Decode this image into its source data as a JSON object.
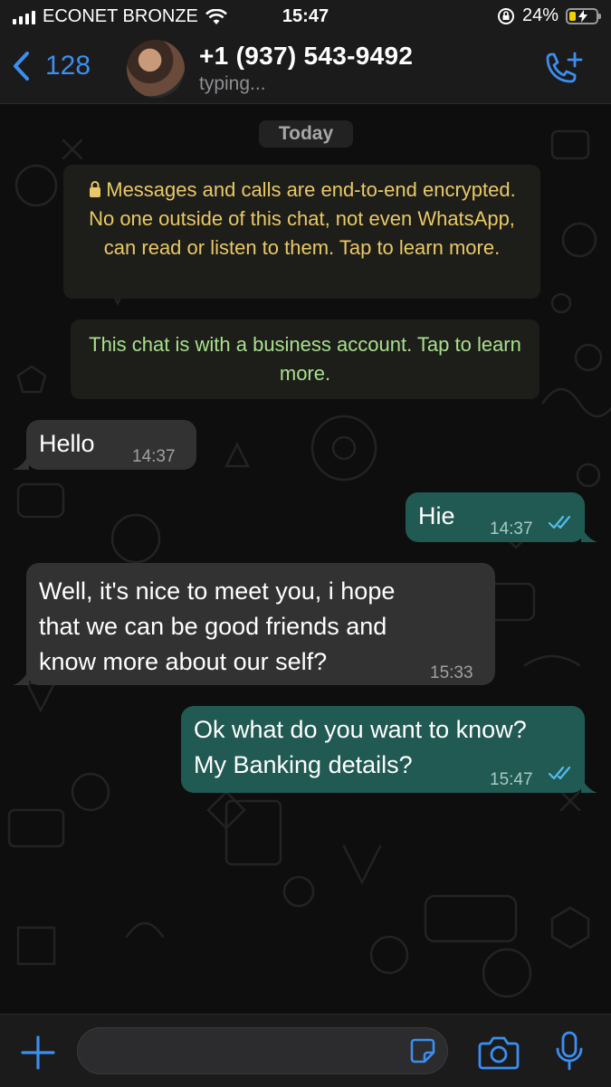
{
  "status_bar": {
    "carrier": "ECONET BRONZE",
    "time": "15:47",
    "battery": "24%",
    "battery_level": 0.24
  },
  "header": {
    "back_count": "128",
    "contact_name": "+1 (937) 543-9492",
    "contact_status": "typing...",
    "icons": [
      "chevron-left-icon",
      "avatar",
      "add-call-icon"
    ]
  },
  "chat": {
    "day_label": "Today",
    "encryption_notice": "Messages and calls are end-to-end encrypted. No one outside of this chat, not even WhatsApp, can read or listen to them. Tap to learn more.",
    "business_notice": "This chat is with a business account. Tap to learn more.",
    "messages": [
      {
        "direction": "incoming",
        "lines": [
          "Hello"
        ],
        "time": "14:37"
      },
      {
        "direction": "outgoing",
        "lines": [
          "Hie"
        ],
        "time": "14:37",
        "read": true
      },
      {
        "direction": "incoming",
        "lines": [
          "Well, it's nice to meet you, i hope",
          "that we can be good friends and",
          "know more about our self?"
        ],
        "time": "15:33"
      },
      {
        "direction": "outgoing",
        "lines": [
          "Ok what do you want to know?",
          "My Banking details?"
        ],
        "time": "15:47",
        "read": true
      }
    ]
  },
  "input_bar": {
    "value": "",
    "icons": [
      "plus-icon",
      "sticker-icon",
      "camera-icon",
      "microphone-icon"
    ]
  },
  "colors": {
    "accent": "#3b8ff0",
    "outgoing_bubble": "#205a52",
    "incoming_bubble": "#323232",
    "encryption_text": "#e9c965",
    "business_text": "#a8e08c"
  }
}
